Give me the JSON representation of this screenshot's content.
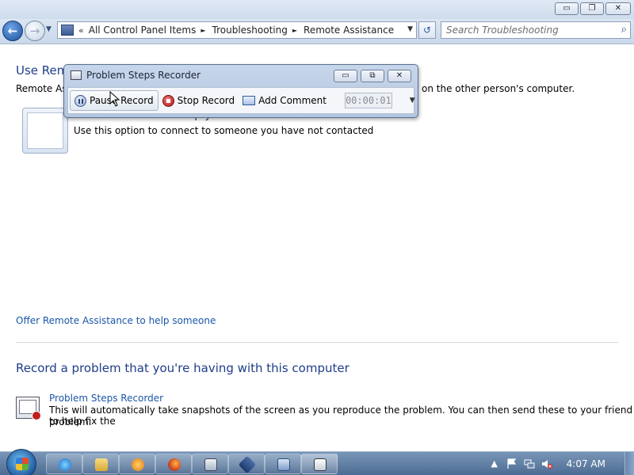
{
  "window": {
    "min_glyph": "▭",
    "max_glyph": "❐",
    "close_glyph": "✕"
  },
  "nav": {
    "back_glyph": "←",
    "forward_glyph": "→",
    "history_glyph": "▼",
    "address_chevron": "«",
    "breadcrumbs": [
      "All Control Panel Items",
      "Troubleshooting",
      "Remote Assistance"
    ],
    "crumb_separator": "►",
    "address_dropdown_glyph": "▼",
    "refresh_glyph": "↺",
    "search_placeholder": "Search Troubleshooting",
    "search_icon_glyph": "⌕"
  },
  "content": {
    "heading_use_remote": "Use Remote Assistance",
    "remote_desc_start": "Remote Assistance lets you get or give help",
    "remote_desc_end": "on the other person's computer.",
    "invite_title": "Invite someone to help you.",
    "invite_desc": "Use this option to connect to someone you have not contacted",
    "offer_link": "Offer Remote Assistance to help someone",
    "record_heading": "Record a problem that you're having with this computer",
    "psr_link": "Problem Steps Recorder",
    "psr_desc_line1": "This will automatically take snapshots of the screen as you reproduce the problem. You can then send these to your friend to help fix the",
    "psr_desc_line2": "problem."
  },
  "psr_window": {
    "title": "Problem Steps Recorder",
    "pause_label": "Pause Record",
    "stop_label": "Stop Record",
    "comment_label": "Add Comment",
    "timer": "00:00:01",
    "help_dropdown_glyph": "▼",
    "min_glyph": "▭",
    "restore_glyph": "⧉",
    "close_glyph": "✕"
  },
  "taskbar": {
    "clock": "4:07 AM",
    "tray_up_glyph": "▲",
    "apps": [
      "ie",
      "explorer",
      "media-player",
      "firefox",
      "control-panel",
      "virtualbox",
      "remote-desktop",
      "steps-recorder"
    ]
  },
  "colors": {
    "heading_blue": "#1e3d8a",
    "link_blue": "#1a56a8",
    "taskbar": "#4d6c92"
  }
}
